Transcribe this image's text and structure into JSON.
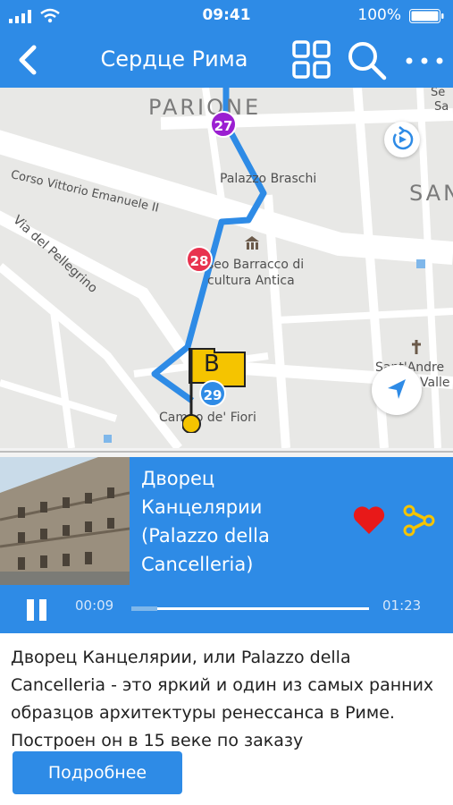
{
  "status_bar": {
    "time": "09:41",
    "battery": "100%"
  },
  "header": {
    "title": "Сердце Рима"
  },
  "map": {
    "labels": {
      "parione": "PARIONE",
      "palazzo_braschi": "Palazzo Braschi",
      "corso": "Corso Vittorio Emanuele II",
      "pellegrino": "Via del Pellegrino",
      "museo_line1": "seo Barracco di",
      "museo_line2": "cultura Antica",
      "campo": "Campo de' Fiori",
      "sant_andrea_line1": "Sant'Andre",
      "sant_andrea_line2": "Valle",
      "sa_edge": "SAN",
      "se_edge1": "Se",
      "se_edge2": "Sa"
    },
    "stops": [
      {
        "number": "27",
        "color": "#9b1fd1"
      },
      {
        "number": "28",
        "color": "#e8334f"
      },
      {
        "number": "29",
        "color": "#2e8be6"
      }
    ],
    "flag_letter": "B"
  },
  "player": {
    "title": "Дворец Канцелярии (Palazzo della Cancelleria)",
    "elapsed": "00:09",
    "duration": "01:23",
    "progress": 0.11
  },
  "description": "Дворец Канцелярии, или Palazzo della Cancelleria - это яркий и один из самых ранних образцов архитектуры ренессанса в Риме. Построен он в 15 веке по заказу",
  "more_button": "Подробнее"
}
